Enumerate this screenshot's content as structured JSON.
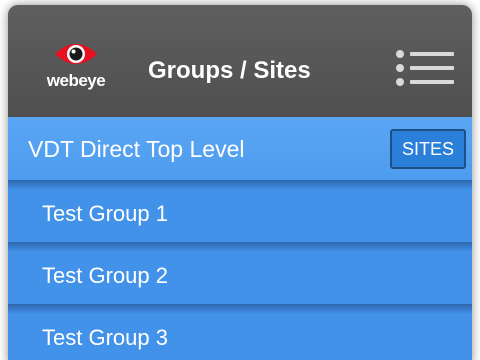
{
  "header": {
    "logo_text": "webeye",
    "title": "Groups / Sites",
    "menu_icon": "menu-list-icon"
  },
  "top_level": {
    "label": "VDT Direct Top Level",
    "sites_button": "SITES"
  },
  "groups": [
    {
      "label": "Test Group 1"
    },
    {
      "label": "Test Group 2"
    },
    {
      "label": "Test Group 3"
    }
  ],
  "colors": {
    "header": "#555555",
    "row_blue": "#4392ea",
    "top_row_blue": "#55a1f1",
    "logo_red": "#e8101e",
    "sites_button": "#2a7fd9"
  }
}
